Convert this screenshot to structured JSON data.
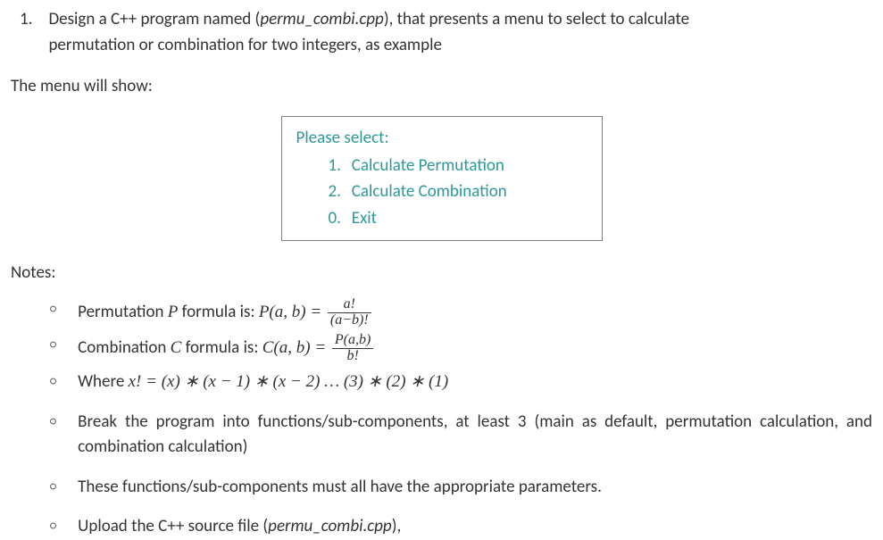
{
  "question": {
    "number": "1.",
    "line1_a": "Design a C++ program named (",
    "line1_b": "permu_combi.cpp",
    "line1_c": "), that presents a menu to select to calculate",
    "line2": "permutation or combination for two integers, as example"
  },
  "menu_intro": "The menu will show:",
  "menu": {
    "header": "Please select:",
    "items": [
      {
        "num": "1.",
        "label": "Calculate Permutation"
      },
      {
        "num": "2.",
        "label": "Calculate Combination"
      },
      {
        "num": "0.",
        "label": "Exit"
      }
    ]
  },
  "notes_header": "Notes:",
  "notes": {
    "n0_a": "Permutation ",
    "n0_b": "P",
    "n0_c": " formula is: ",
    "n0_formula_lhs": "P(a, b) = ",
    "n0_num": "a!",
    "n0_den": "(a−b)!",
    "n1_a": "Combination ",
    "n1_b": "C",
    "n1_c": " formula is: ",
    "n1_formula_lhs": "C(a, b) = ",
    "n1_num": "P(a,b)",
    "n1_den": "b!",
    "n2_a": "Where ",
    "n2_formula": "x!  =  (x) ∗ (x − 1) ∗ (x − 2) … (3) ∗ (2) ∗ (1)",
    "n3": "Break the program into functions/sub-components, at least 3 (main as default, permutation calculation, and combination calculation)",
    "n4": "These functions/sub-components must all have the appropriate parameters.",
    "n5_a": "Upload the C++ source file (",
    "n5_b": "permu_combi.cpp",
    "n5_c": "),"
  }
}
